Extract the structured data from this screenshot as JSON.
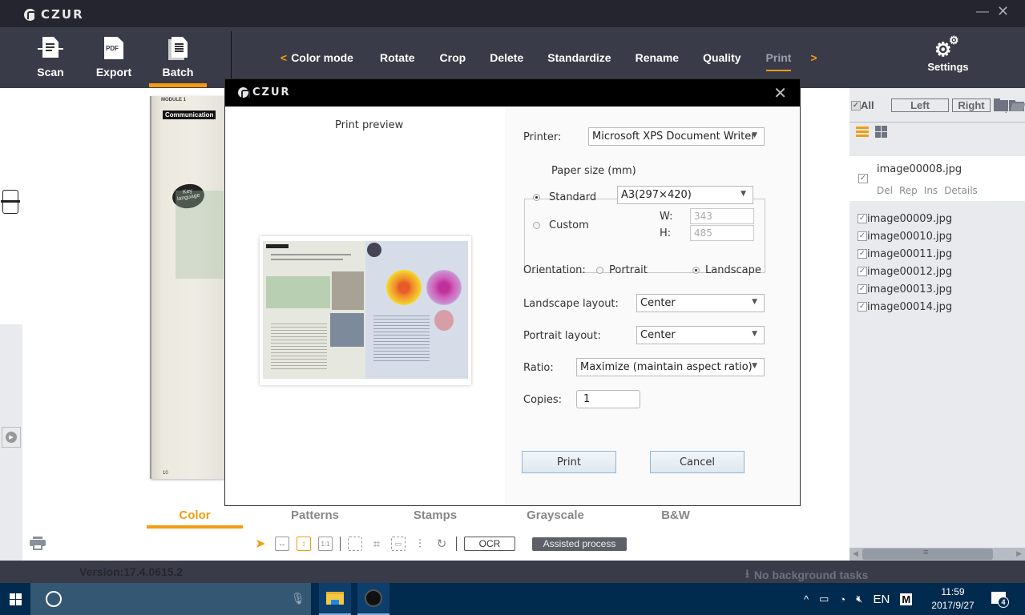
{
  "app": {
    "title": "CZUR",
    "minimize_icon": "minimize-icon",
    "close_icon": "close-icon"
  },
  "toolbar": {
    "main_buttons": [
      {
        "label": "Scan",
        "icon": "scan-icon"
      },
      {
        "label": "Export",
        "icon": "pdf-icon",
        "icon_text": "PDF"
      },
      {
        "label": "Batch",
        "icon": "batch-documents-icon",
        "active": true
      }
    ],
    "menu_prev": "<",
    "menu_items": [
      "Color mode",
      "Rotate",
      "Crop",
      "Delete",
      "Standardize",
      "Rename",
      "Quality",
      "Print"
    ],
    "menu_active": "Print",
    "menu_next": ">",
    "settings_label": "Settings",
    "accent_color": "#f39c12"
  },
  "canvas": {
    "page_heading": "Communication",
    "page_module": "MODULE 1",
    "page_badge": "Key language",
    "page_number": "10"
  },
  "mode_tabs": {
    "items": [
      "Color",
      "Patterns",
      "Stamps",
      "Grayscale",
      "B&W"
    ],
    "active": "Color"
  },
  "bottom_tools": {
    "icons": [
      "pointer-icon",
      "fit-width-icon",
      "fit-height-icon",
      "actual-size-icon",
      "select-area-icon",
      "crop-icon",
      "deskew-icon",
      "adjust-icon",
      "rotate-icon"
    ],
    "actual_size_text": "1:1",
    "ocr_label": "OCR",
    "assisted_label": "Assisted process"
  },
  "status": {
    "version": "Version:17.4.0615.2",
    "background_tasks": "No background tasks"
  },
  "right_panel": {
    "all_label": "All",
    "left_label": "Left",
    "right_label": "Right",
    "selected_file": {
      "name": "image00008.jpg",
      "actions": [
        "Del",
        "Rep",
        "Ins",
        "Details"
      ]
    },
    "files": [
      "image00009.jpg",
      "image00010.jpg",
      "image00011.jpg",
      "image00012.jpg",
      "image00013.jpg",
      "image00014.jpg"
    ]
  },
  "dialog": {
    "title": "CZUR",
    "preview_label": "Print preview",
    "printer_label": "Printer:",
    "printer_value": "Microsoft XPS Document Writer",
    "paper_size_label": "Paper size (mm)",
    "standard_label": "Standard",
    "standard_value": "A3(297×420)",
    "custom_label": "Custom",
    "w_label": "W:",
    "w_value": "343",
    "h_label": "H:",
    "h_value": "485",
    "paper_mode": "Standard",
    "orientation_label": "Orientation:",
    "portrait_label": "Portrait",
    "landscape_label": "Landscape",
    "orientation_value": "Landscape",
    "landscape_layout_label": "Landscape layout:",
    "landscape_layout_value": "Center",
    "portrait_layout_label": "Portrait layout:",
    "portrait_layout_value": "Center",
    "ratio_label": "Ratio:",
    "ratio_value": "Maximize (maintain aspect ratio)",
    "copies_label": "Copies:",
    "copies_value": "1",
    "print_button": "Print",
    "cancel_button": "Cancel"
  },
  "taskbar": {
    "tray_language": "EN",
    "tray_ime": "M",
    "time": "11:59",
    "date": "2017/9/27",
    "notification_count": "4"
  }
}
